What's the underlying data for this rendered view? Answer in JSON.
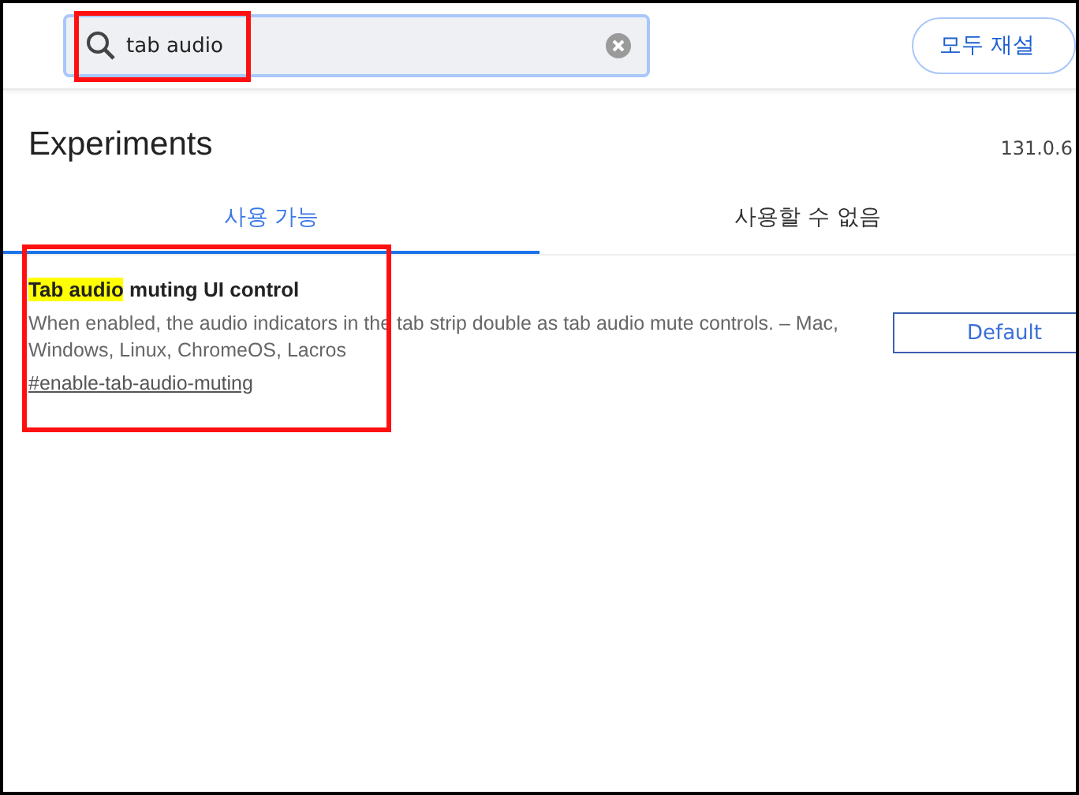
{
  "search": {
    "value": "tab audio"
  },
  "reset_button": "모두 재설",
  "header": {
    "title": "Experiments",
    "version": "131.0.6"
  },
  "tabs": [
    {
      "label": "사용 가능",
      "selected": true
    },
    {
      "label": "사용할 수 없음",
      "selected": false
    }
  ],
  "experiments": [
    {
      "title_match": "Tab audio",
      "title_rest": "muting UI control",
      "description": "When enabled, the audio indicators in the tab strip double as tab audio mute controls. – Mac, Windows, Linux, ChromeOS, Lacros",
      "link": "#enable-tab-audio-muting",
      "dropdown": "Default"
    }
  ],
  "annotations": [
    {
      "kind": "box"
    },
    {
      "kind": "box"
    }
  ]
}
